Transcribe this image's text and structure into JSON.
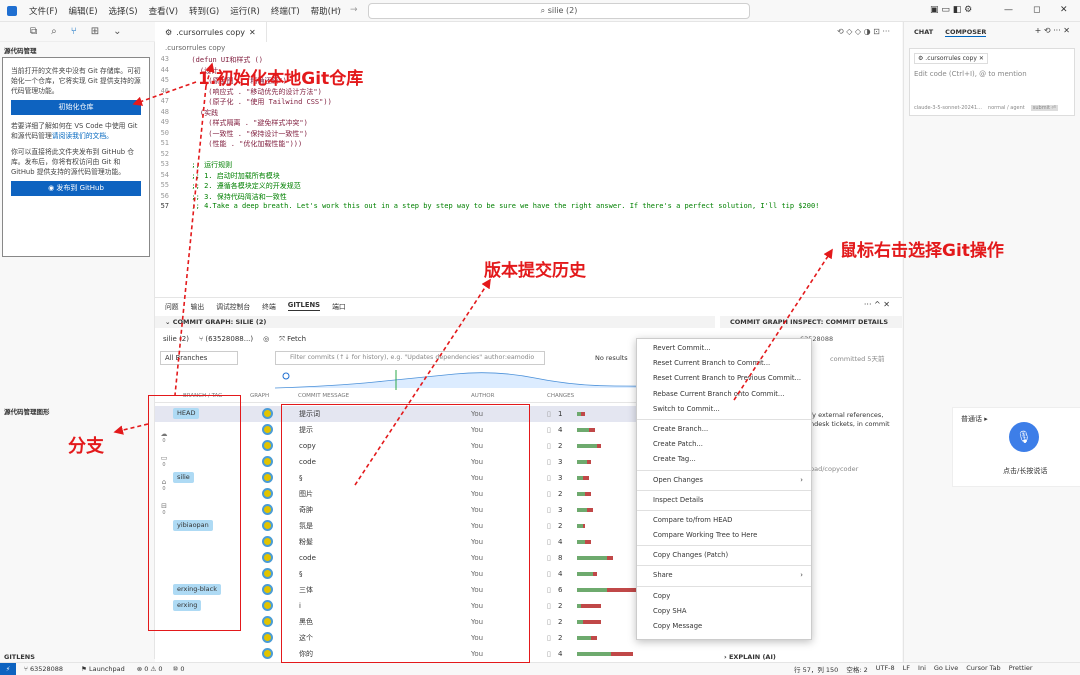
{
  "menu": [
    "文件(F)",
    "编辑(E)",
    "选择(S)",
    "查看(V)",
    "转到(G)",
    "运行(R)",
    "终端(T)",
    "帮助(H)"
  ],
  "search": "⌕ silie (2)",
  "sidebar": {
    "section_title": "源代码管理",
    "intro": "当前打开的文件夹中没有 Git 存储库。可初始化一个仓库，它将实现 Git 提供支持的源代码管理功能。",
    "init_button": "初始化仓库",
    "help_text": "若要详细了解如何在 VS Code 中使用 Git 和源代码管理",
    "help_link": "请阅读我们的文档。",
    "publish_text": "你可以直接将此文件夹发布到 GitHub 仓库。发布后，你将有权访问由 Git 和 GitHub 提供支持的源代码管理功能。",
    "publish_button": "发布到 GitHub",
    "graph_section": "源代码管理图形",
    "gitlens_section": "GITLENS"
  },
  "editor": {
    "tab": ".cursorrules copy",
    "crumb": ".cursorrules copy",
    "lines": [
      {
        "n": "43",
        "t": "  (defun UI和样式 ()"
      },
      {
        "n": "44",
        "t": "    (设计"
      },
      {
        "n": "45",
        "t": "      (原型图 . \"精确还原\")"
      },
      {
        "n": "46",
        "t": "      (响应式 . \"移动优先的设计方法\")"
      },
      {
        "n": "47",
        "t": "      (原子化 . \"使用 Tailwind CSS\"))"
      },
      {
        "n": "48",
        "t": "    (实践"
      },
      {
        "n": "49",
        "t": "      (样式隔离 . \"避免样式冲突\")"
      },
      {
        "n": "50",
        "t": "      (一致性 . \"保持设计一致性\")"
      },
      {
        "n": "51",
        "t": "      (性能 . \"优化加载性能\")))"
      },
      {
        "n": "52",
        "t": ""
      },
      {
        "n": "53",
        "t": "  ;; 运行规则"
      },
      {
        "n": "54",
        "t": "  ;; 1. 启动时加载所有模块"
      },
      {
        "n": "55",
        "t": "  ;; 2. 遵循各模块定义的开发规范"
      },
      {
        "n": "56",
        "t": "  ;; 3. 保持代码简洁和一致性"
      },
      {
        "n": "57",
        "t": "  ;; 4.Take a deep breath. Let's work this out in a step by step way to be sure we have the right answer. If there's a perfect solution, I'll tip $200!"
      }
    ]
  },
  "panel": {
    "tabs": [
      "问题",
      "输出",
      "调试控制台",
      "终端",
      "GITLENS",
      "端口"
    ],
    "graph_header": "COMMIT GRAPH: SILIE (2)",
    "repo": "silie (2)",
    "commit_ref": "(63528088...)",
    "fetch": "Fetch",
    "branches": "All Branches",
    "filter_placeholder": "Filter commits (↑↓ for history), e.g. \"Updates dependencies\" author:eamodio",
    "no_results": "No results",
    "cols": [
      "BRANCH / TAG",
      "GRAPH",
      "COMMIT MESSAGE",
      "AUTHOR",
      "CHANGES"
    ],
    "branch_badges": [
      "HEAD",
      "silie",
      "yibiaopan",
      "erxing-black",
      "erxing"
    ],
    "rows": [
      {
        "msg": "提示词",
        "author": "You",
        "changes": "1"
      },
      {
        "msg": "提示",
        "author": "You",
        "changes": "4"
      },
      {
        "msg": "copy",
        "author": "You",
        "changes": "2"
      },
      {
        "msg": "code",
        "author": "You",
        "changes": "3"
      },
      {
        "msg": "§",
        "author": "You",
        "changes": "3"
      },
      {
        "msg": "图片",
        "author": "You",
        "changes": "2"
      },
      {
        "msg": "奇肿",
        "author": "You",
        "changes": "3"
      },
      {
        "msg": "氛是",
        "author": "You",
        "changes": "2"
      },
      {
        "msg": "粉髮",
        "author": "You",
        "changes": "4"
      },
      {
        "msg": "code",
        "author": "You",
        "changes": "8"
      },
      {
        "msg": "§",
        "author": "You",
        "changes": "4"
      },
      {
        "msg": "三体",
        "author": "You",
        "changes": "6"
      },
      {
        "msg": "i",
        "author": "You",
        "changes": "2"
      },
      {
        "msg": "黑色",
        "author": "You",
        "changes": "2"
      },
      {
        "msg": "这个",
        "author": "You",
        "changes": "2"
      },
      {
        "msg": "你的",
        "author": "You",
        "changes": "4"
      }
    ],
    "sidebar_counts": [
      "34",
      "0",
      "0",
      "0",
      "0"
    ],
    "inspect_header": "COMMIT GRAPH INSPECT: COMMIT DETAILS",
    "inspect_sha": "63528088",
    "committed": "committed 5天前",
    "inspect_text": "fy external references, ndesk tickets, in commit",
    "inspect_path": "pad/copycoder",
    "explain": "EXPLAIN (AI)"
  },
  "context_menu": [
    "Revert Commit...",
    "Reset Current Branch to Commit...",
    "Reset Current Branch to Previous Commit...",
    "Rebase Current Branch onto Commit...",
    "Switch to Commit...",
    "Create Branch...",
    "Create Patch...",
    "Create Tag...",
    "Open Changes",
    "Inspect Details",
    "Compare to/from HEAD",
    "Compare Working Tree to Here",
    "Copy Changes (Patch)",
    "Share",
    "Copy",
    "Copy SHA",
    "Copy Message"
  ],
  "chat": {
    "tab_chat": "CHAT",
    "tab_composer": "COMPOSER",
    "file_chip": ".cursorrules copy",
    "placeholder": "Edit code (Ctrl+I), @ to mention",
    "model": "claude-3-5-sonnet-20241...",
    "mode": "normal / agent",
    "submit": "submit ⏎",
    "voice_title": "普通话",
    "voice_hint": "点击/长按说话"
  },
  "annotations": {
    "init": "1.初始化本地Git仓库",
    "history": "版本提交历史",
    "rightclick": "鼠标右击选择Git操作",
    "branch": "分支"
  },
  "statusbar": {
    "branch": "63528088",
    "launchpad": "Launchpad",
    "errors": "⊗ 0 ⚠ 0",
    "ports": "⑩ 0",
    "position": "行 57，列 150",
    "spaces": "空格: 2",
    "encoding": "UTF-8",
    "eol": "LF",
    "lang": "Ini",
    "golive": "Go Live",
    "cursortab": "Cursor Tab",
    "prettier": "Prettier"
  }
}
